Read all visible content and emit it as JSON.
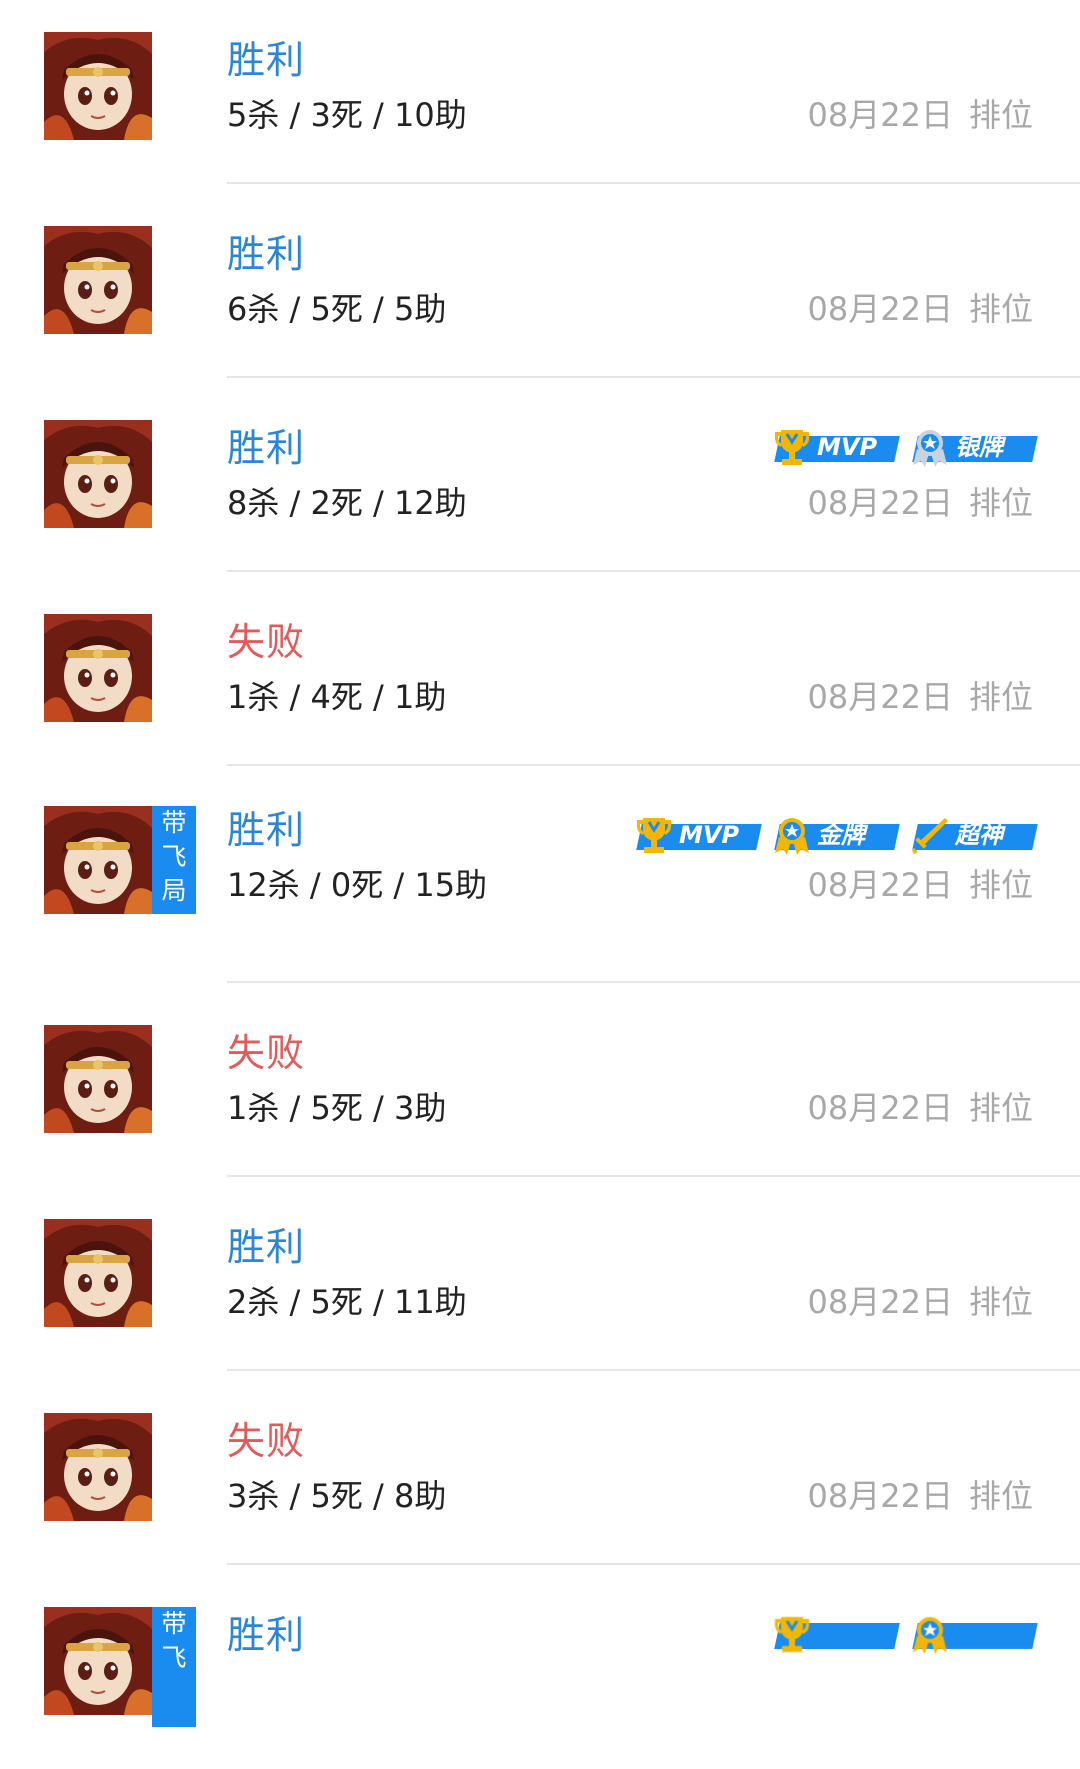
{
  "matches": [
    {
      "result": "胜利",
      "status": "win",
      "kda": "5杀 / 3死 / 10助",
      "date": "08月22日",
      "mode": "排位",
      "carry": null,
      "badges": []
    },
    {
      "result": "胜利",
      "status": "win",
      "kda": "6杀 / 5死 / 5助",
      "date": "08月22日",
      "mode": "排位",
      "carry": null,
      "badges": []
    },
    {
      "result": "胜利",
      "status": "win",
      "kda": "8杀 / 2死 / 12助",
      "date": "08月22日",
      "mode": "排位",
      "carry": null,
      "badges": [
        {
          "label": "MVP",
          "icon": "trophy-icon"
        },
        {
          "label": "银牌",
          "icon": "silver-medal-icon"
        }
      ]
    },
    {
      "result": "失败",
      "status": "loss",
      "kda": "1杀 / 4死 / 1助",
      "date": "08月22日",
      "mode": "排位",
      "carry": null,
      "badges": []
    },
    {
      "result": "胜利",
      "status": "win",
      "kda": "12杀 / 0死 / 15助",
      "date": "08月22日",
      "mode": "排位",
      "carry": [
        "带",
        "飞",
        "局"
      ],
      "badges": [
        {
          "label": "MVP",
          "icon": "trophy-icon"
        },
        {
          "label": "金牌",
          "icon": "gold-medal-icon"
        },
        {
          "label": "超神",
          "icon": "sword-icon"
        }
      ]
    },
    {
      "result": "失败",
      "status": "loss",
      "kda": "1杀 / 5死 / 3助",
      "date": "08月22日",
      "mode": "排位",
      "carry": null,
      "badges": []
    },
    {
      "result": "胜利",
      "status": "win",
      "kda": "2杀 / 5死 / 11助",
      "date": "08月22日",
      "mode": "排位",
      "carry": null,
      "badges": []
    },
    {
      "result": "失败",
      "status": "loss",
      "kda": "3杀 / 5死 / 8助",
      "date": "08月22日",
      "mode": "排位",
      "carry": null,
      "badges": []
    },
    {
      "result": "胜利",
      "status": "win",
      "kda": "",
      "date": "",
      "mode": "",
      "carry": [
        "带",
        "飞"
      ],
      "badges": [
        {
          "label": "",
          "icon": "trophy-icon"
        },
        {
          "label": "",
          "icon": "gold-medal-icon"
        }
      ]
    }
  ],
  "colors": {
    "win": "#2b86d6",
    "loss": "#e25b5b",
    "badge": "#1a8cf0",
    "meta": "#a8a8a8",
    "accent_gold": "#f2b705"
  }
}
